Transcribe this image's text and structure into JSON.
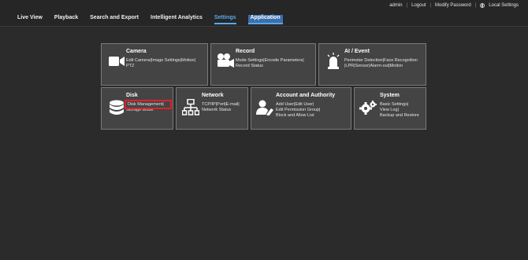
{
  "header": {
    "user": "admin",
    "logout": "Logout",
    "modify_password": "Modify Password",
    "local_settings": "Local Settings"
  },
  "nav": {
    "live_view": "Live View",
    "playback": "Playback",
    "search_export": "Search and Export",
    "intelligent_analytics": "Intelligent Analytics",
    "settings": "Settings",
    "application": "Application"
  },
  "cards": {
    "camera": {
      "title": "Camera",
      "line1": "Edit Camera|Image Settings|Motion|",
      "line2": "PTZ"
    },
    "record": {
      "title": "Record",
      "line1": "Mode Settings|Encode Parameters|",
      "line2": "Record Status"
    },
    "ai_event": {
      "title": "AI / Event",
      "line1": "Perimeter Detection|Face Recognition",
      "line2": "|LPR|Sensor|Alarm-out|Motion"
    },
    "disk": {
      "title": "Disk",
      "line1": "Disk Management|",
      "line2": "Storage Mode"
    },
    "network": {
      "title": "Network",
      "line1": "TCP/IP|Port|E-mail|",
      "line2": "Network Status"
    },
    "account": {
      "title": "Account and Authority",
      "line1": "Add User|Edit User|",
      "line2": "Edit Permission Group|",
      "line3": "Block and Allow List"
    },
    "system": {
      "title": "System",
      "line1": "Basic Settings|",
      "line2": "View Log|",
      "line3": "Backup and Restore"
    }
  },
  "colors": {
    "background": "#2b2b2b",
    "card": "#444444",
    "accent": "#5aa8e8",
    "highlight": "#e0202a"
  }
}
